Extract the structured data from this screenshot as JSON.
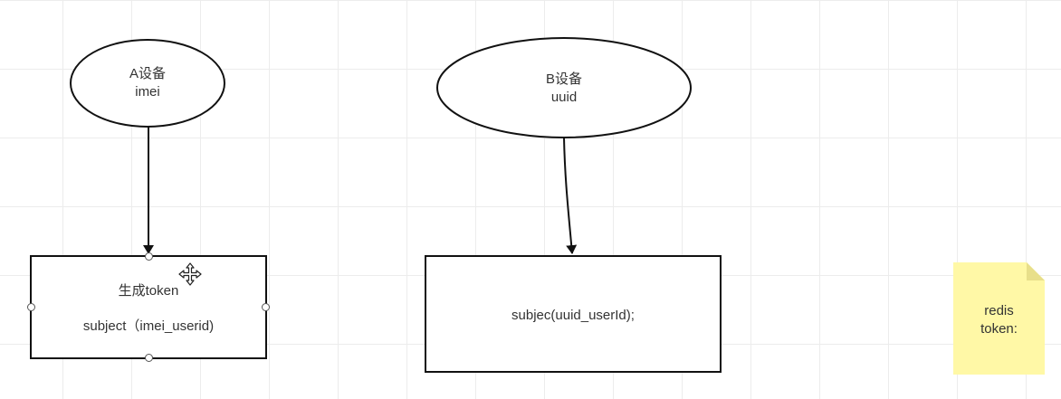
{
  "nodes": {
    "a_device": {
      "line1": "A设备",
      "line2": "imei"
    },
    "b_device": {
      "line1": "B设备",
      "line2": "uuid"
    },
    "token_box": {
      "title": "生成token",
      "subtitle": "subject（imei_userid)"
    },
    "subject_box": {
      "text": "subjec(uuid_userId);"
    },
    "redis_note": {
      "line1": "redis",
      "line2": "token:"
    }
  },
  "colors": {
    "stroke": "#111111",
    "note_fill": "#fff8a6",
    "note_fold": "#e8df8a",
    "grid": "#ececec"
  },
  "icons": {
    "cursor": "move-cursor-icon"
  }
}
